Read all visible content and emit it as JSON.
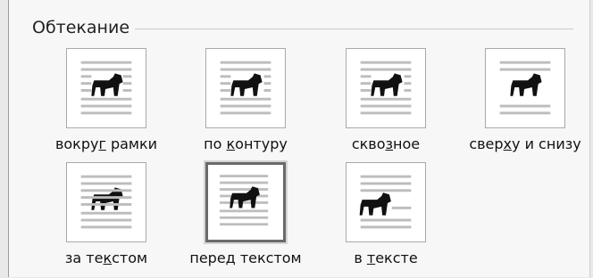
{
  "group": {
    "title": "Обтекание"
  },
  "options": [
    {
      "id": "around",
      "pre": "вокру",
      "key": "г",
      "post": " рамки",
      "selected": false,
      "icon": "wrap-around-frame-icon"
    },
    {
      "id": "contour",
      "pre": "по ",
      "key": "к",
      "post": "онтуру",
      "selected": false,
      "icon": "wrap-contour-icon"
    },
    {
      "id": "through",
      "pre": "скво",
      "key": "з",
      "post": "ное",
      "selected": false,
      "icon": "wrap-through-icon"
    },
    {
      "id": "topbottom",
      "pre": "свер",
      "key": "х",
      "post": "у и снизу",
      "selected": false,
      "icon": "wrap-top-bottom-icon"
    },
    {
      "id": "behind",
      "pre": "за те",
      "key": "к",
      "post": "стом",
      "selected": false,
      "icon": "wrap-behind-text-icon"
    },
    {
      "id": "infront",
      "pre": "перед текстом",
      "key": "",
      "post": "",
      "selected": true,
      "icon": "wrap-in-front-of-text-icon"
    },
    {
      "id": "inline",
      "pre": "в ",
      "key": "т",
      "post": "ексте",
      "selected": false,
      "icon": "wrap-inline-icon"
    }
  ]
}
